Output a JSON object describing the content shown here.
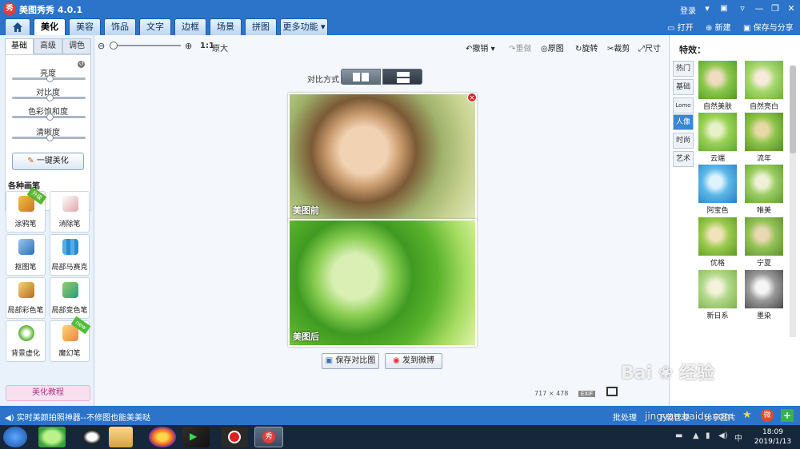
{
  "titlebar": {
    "title": "美图秀秀 4.0.1",
    "logo_text": "秀",
    "login": "登录"
  },
  "main_tabs": [
    "美化",
    "美容",
    "饰品",
    "文字",
    "边框",
    "场景",
    "拼图",
    "更多功能"
  ],
  "tab_actions": {
    "open": "打开",
    "new": "新建",
    "save_share": "保存与分享"
  },
  "left_tabs": [
    "基础",
    "高级",
    "调色"
  ],
  "sliders": [
    "亮度",
    "对比度",
    "色彩饱和度",
    "清晰度"
  ],
  "one_key": "一键美化",
  "brushes_header": "各种画笔",
  "brushes": [
    {
      "label": "涂鸦笔",
      "badge": "升级"
    },
    {
      "label": "消除笔",
      "badge": ""
    },
    {
      "label": "抠图笔",
      "badge": ""
    },
    {
      "label": "局部马赛克",
      "badge": ""
    },
    {
      "label": "局部彩色笔",
      "badge": ""
    },
    {
      "label": "局部变色笔",
      "badge": ""
    },
    {
      "label": "背景虚化",
      "badge": ""
    },
    {
      "label": "魔幻笔",
      "badge": "new"
    }
  ],
  "tutorial": "美化教程",
  "toolbar": {
    "ratio": "1:1",
    "original_size": "原大",
    "undo": "撤销",
    "redo": "重做",
    "original": "原图",
    "rotate": "旋转",
    "crop": "裁剪",
    "size": "尺寸"
  },
  "compare": {
    "label": "对比方式",
    "before": "美图前",
    "after": "美图后",
    "save_compare": "保存对比图",
    "post_weibo": "发到微博"
  },
  "image_dims": {
    "width": "717",
    "height": "478",
    "exif": "EXIF"
  },
  "effects": {
    "header": "特效：",
    "categories": [
      "热门",
      "基础",
      "Lomo",
      "人像",
      "时尚",
      "艺术"
    ],
    "active_category": "人像",
    "items": [
      "自然美肤",
      "自然亮白",
      "云端",
      "流年",
      "阿宝色",
      "唯美",
      "优格",
      "宁夏",
      "新日系",
      "墨染"
    ]
  },
  "status": {
    "text": "实时美颜拍照神器--不修图也能美美哒",
    "batch": "批处理",
    "download": "下载管理",
    "share": "分享图片"
  },
  "clock": {
    "time": "18:09",
    "date": "2019/1/13"
  },
  "watermark": {
    "brand": "Bai",
    "brand_cn": "经验",
    "url": "jingyan.baidu.com"
  },
  "colors": {
    "accent": "#2b74c9",
    "taskbar": "#16263b"
  }
}
